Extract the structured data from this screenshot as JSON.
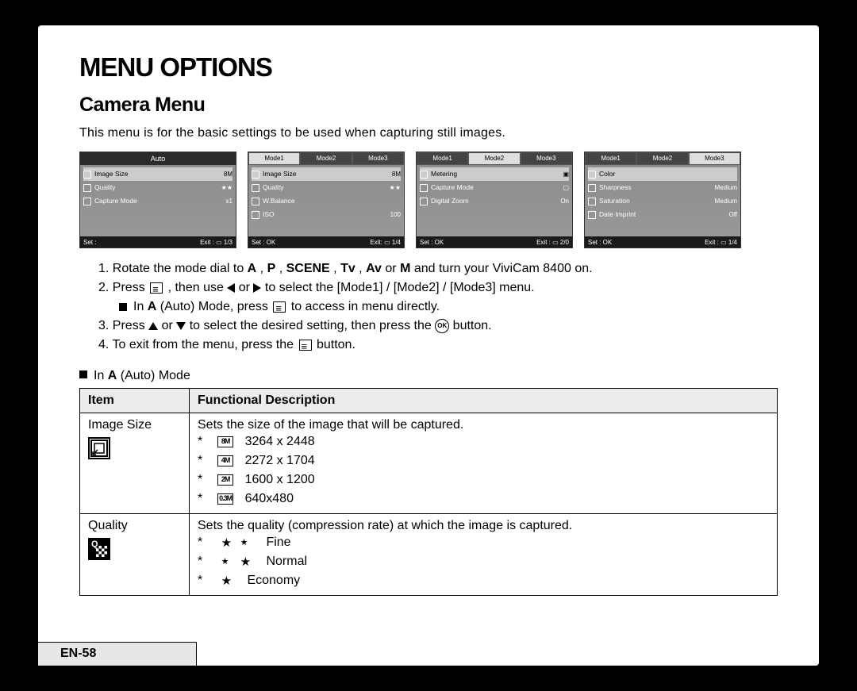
{
  "title": "MENU OPTIONS",
  "section": "Camera Menu",
  "intro": "This menu is for the basic settings to be used when capturing still images.",
  "screens": [
    {
      "top_mode": "Auto",
      "tabs": null,
      "rows": [
        {
          "icon": "img",
          "label": "Image Size",
          "value": "8M",
          "hl": true
        },
        {
          "icon": "q",
          "label": "Quality",
          "value": "★★",
          "hl": false
        },
        {
          "icon": "cam",
          "label": "Capture Mode",
          "value": "x1",
          "hl": false
        }
      ],
      "footer_l": "Set :",
      "footer_r": "Exit : ▭ 1/3"
    },
    {
      "top_mode": null,
      "tabs": [
        {
          "t": "Mode1",
          "act": true
        },
        {
          "t": "Mode2",
          "act": false
        },
        {
          "t": "Mode3",
          "act": false
        }
      ],
      "rows": [
        {
          "icon": "img",
          "label": "Image Size",
          "value": "8M",
          "hl": true
        },
        {
          "icon": "q",
          "label": "Quality",
          "value": "★★",
          "hl": false
        },
        {
          "icon": "wb",
          "label": "W.Balance",
          "value": "",
          "hl": false
        },
        {
          "icon": "iso",
          "label": "ISO",
          "value": "100",
          "hl": false
        }
      ],
      "footer_l": "Set : OK",
      "footer_r": "Exit: ▭ 1/4"
    },
    {
      "top_mode": null,
      "tabs": [
        {
          "t": "Mode1",
          "act": false
        },
        {
          "t": "Mode2",
          "act": true
        },
        {
          "t": "Mode3",
          "act": false
        }
      ],
      "rows": [
        {
          "icon": "m",
          "label": "Metering",
          "value": "▣",
          "hl": true
        },
        {
          "icon": "cam",
          "label": "Capture Mode",
          "value": "▢",
          "hl": false
        },
        {
          "icon": "dz",
          "label": "Digital Zoom",
          "value": "On",
          "hl": false
        }
      ],
      "footer_l": "Set : OK",
      "footer_r": "Exit : ▭ 2/0"
    },
    {
      "top_mode": null,
      "tabs": [
        {
          "t": "Mode1",
          "act": false
        },
        {
          "t": "Mode2",
          "act": false
        },
        {
          "t": "Mode3",
          "act": true
        }
      ],
      "rows": [
        {
          "icon": "c",
          "label": "Color",
          "value": "",
          "hl": true
        },
        {
          "icon": "s",
          "label": "Sharpness",
          "value": "Medium",
          "hl": false
        },
        {
          "icon": "sa",
          "label": "Saturation",
          "value": "Medium",
          "hl": false
        },
        {
          "icon": "d",
          "label": "Date Imprint",
          "value": "Off",
          "hl": false
        }
      ],
      "footer_l": "Set : OK",
      "footer_r": "Exit : ▭ 1/4"
    }
  ],
  "steps": {
    "s1a": "1.  Rotate the mode dial to ",
    "s1_bold": [
      "A",
      " , ",
      "P",
      " , ",
      "SCENE",
      " , ",
      "Tv",
      " , ",
      "Av"
    ],
    "s1b": " or ",
    "s1_m": "M",
    "s1c": " and turn your ViviCam 8400 on.",
    "s2a": "2.  Press ",
    "s2b": " , then use ",
    "s2c": " or ",
    "s2d": " to select the [Mode1] / [Mode2] / [Mode3] menu.",
    "s2sub_a": "In ",
    "s2sub_b": "A",
    "s2sub_c": " (Auto) Mode, press ",
    "s2sub_d": " to access in menu directly.",
    "s3a": "3.  Press ",
    "s3b": " or ",
    "s3c": " to select the desired setting, then press the ",
    "s3d": " button.",
    "s4a": "4.  To exit from the menu, press the ",
    "s4b": " button."
  },
  "mode_note_a": "In ",
  "mode_note_b": "A",
  "mode_note_c": " (Auto) Mode",
  "table": {
    "h1": "Item",
    "h2": "Functional Description",
    "rows": [
      {
        "item": "Image Size",
        "desc": "Sets the size of the image that will be captured.",
        "opts": [
          {
            "tag": "8M",
            "t": "3264 x 2448"
          },
          {
            "tag": "4M",
            "t": "2272 x 1704"
          },
          {
            "tag": "2M",
            "t": "1600 x 1200"
          },
          {
            "tag": "0.3M",
            "t": "640x480"
          }
        ],
        "icon": "size"
      },
      {
        "item": "Quality",
        "desc": "Sets the quality (compression rate) at which the image is captured.",
        "opts": [
          {
            "stars": "fine",
            "t": "Fine"
          },
          {
            "stars": "normal",
            "t": "Normal"
          },
          {
            "stars": "economy",
            "t": "Economy"
          }
        ],
        "icon": "qual"
      }
    ]
  },
  "footer": "EN-58"
}
